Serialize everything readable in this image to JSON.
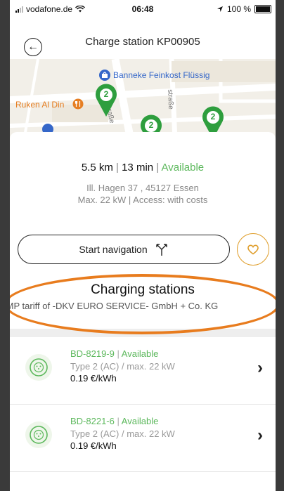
{
  "status_bar": {
    "carrier": "vodafone.de",
    "time": "06:48",
    "battery": "100 %"
  },
  "header": {
    "title": "Charge station KP00905"
  },
  "map": {
    "pois": [
      {
        "label": "Banneke Feinkost Flüssig",
        "icon": "shopping-bag-icon",
        "color": "#3567c9"
      },
      {
        "label": "Ruken Al Din",
        "icon": "restaurant-icon",
        "color": "#e67e22"
      }
    ],
    "streets": [
      "straße",
      "straße"
    ],
    "clusters": [
      "2",
      "2",
      "2"
    ],
    "marker_color": "#2e9e3e"
  },
  "station_info": {
    "distance": "5.5 km",
    "duration": "13 min",
    "availability": "Available",
    "address": "Ill. Hagen 37 , 45127 Essen",
    "details": "Max. 22 kW | Access: with costs"
  },
  "actions": {
    "navigation_label": "Start navigation",
    "navigation_icon": "route-icon",
    "favorite_icon": "heart-icon"
  },
  "charging": {
    "title": "Charging stations",
    "tariff": "EMP tariff of -DKV EURO SERVICE- GmbH + Co. KG"
  },
  "stations": [
    {
      "id": "BD-8219-9",
      "status": "Available",
      "type": "Type 2 (AC) / max. 22 kW",
      "price": "0.19 €/kWh"
    },
    {
      "id": "BD-8221-6",
      "status": "Available",
      "type": "Type 2 (AC) / max. 22 kW",
      "price": "0.19 €/kWh"
    }
  ],
  "colors": {
    "available": "#5cb85c",
    "accent": "#e0a030",
    "highlight": "#e87c1e"
  }
}
